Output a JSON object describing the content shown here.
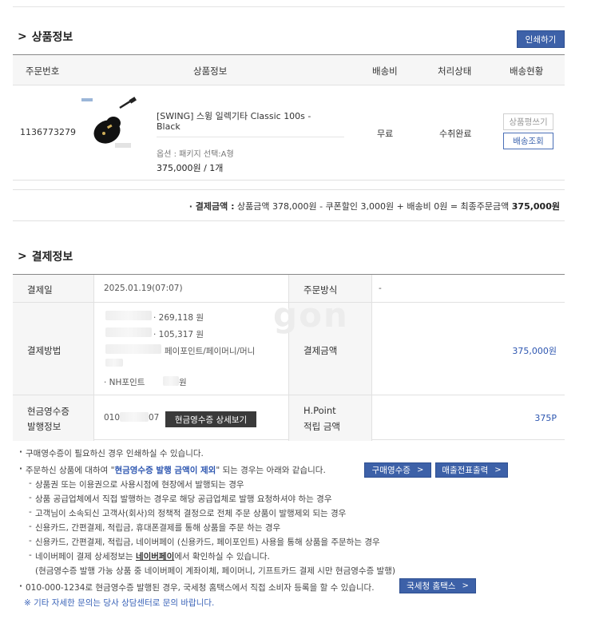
{
  "product_section": {
    "title": "상품정보",
    "print_button": "인쇄하기",
    "headers": [
      "주문번호",
      "상품정보",
      "배송비",
      "처리상태",
      "배송현황"
    ],
    "order": {
      "order_no": "1136773279",
      "product_name_line1": "[SWING] 스윙 일렉기타 Classic 100s -",
      "product_name_line2": "Black",
      "option": "옵션 : 패키지 선택:A형",
      "price_qty": "375,000원 / 1개",
      "shipping_fee": "무료",
      "status": "수취완료",
      "review_button": "상품평쓰기",
      "tracking_button": "배송조회"
    },
    "payment_summary_label": "· 결제금액 :",
    "payment_summary_text": "상품금액 378,000원 - 쿠폰할인 3,000원 + 배송비 0원 = 최종주문금액",
    "payment_summary_total": "375,000원"
  },
  "payment_section": {
    "title": "결제정보",
    "pay_date_label": "결제일",
    "pay_date_value": "2025.01.19(07:07)",
    "order_method_label": "주문방식",
    "order_method_value": "-",
    "pay_method_label": "결제방법",
    "pay_method_lines": [
      "· 269,118 원",
      "· 105,317 원",
      "페이포인트/페이머니/머니",
      "· NH포인트",
      "원"
    ],
    "pay_amount_label": "결제금액",
    "pay_amount_value": "375,000원",
    "receipt_label_line1": "현금영수증",
    "receipt_label_line2": "발행정보",
    "receipt_value_prefix": "010",
    "receipt_value_suffix": "07",
    "receipt_detail_button": "현금영수증 상세보기",
    "hpoint_label_line1": "H.Point",
    "hpoint_label_line2": "적립 금액",
    "hpoint_value": "375P",
    "watermark": "gon"
  },
  "notes": {
    "n1": "구매영수증이 필요하신 경우 인쇄하실 수 있습니다.",
    "n2_pre": "주문하신 상품에 대하여 \"",
    "n2_hl": "현금영수증 발행 금액이 제외",
    "n2_post": "\" 되는 경우는 아래와 같습니다.",
    "btn_purchase_receipt": "구매영수증",
    "btn_sales_slip": "매출전표출력",
    "subs": [
      "상품권 또는 이용권으로 사용시점에 현장에서 발행되는 경우",
      "상품 공급업체에서 직접 발행하는 경우로 해당 공급업체로 발행 요청하셔야 하는 경우",
      "고객님이 소속되신 고객사(회사)의 정책적 결정으로 전체 주문 상품이 발행제외 되는 경우",
      "신용카드, 간편결제, 적립금, 휴대폰결제를 통해 상품을 주문 하는 경우",
      "신용카드, 간편결제, 적립금, 네이버페이 (신용카드, 페이포인트) 사용을 통해 상품을 주문하는 경우"
    ],
    "sub_naver_pre": "네이버페이 결제 상세정보는 ",
    "sub_naver_ul": "네이버페이",
    "sub_naver_post": "에서 확인하실 수 있습니다.",
    "sub_naver_cont": "(현금영수증 발행 가능 상품 중 네이버페이 계좌이체, 페이머니, 기프트카드 결제 시만 현금영수증 발행)",
    "n3": "010-000-1234로 현금영수증 발행된 경우, 국세청 홈택스에서 직접 소비자 등록을 할 수 있습니다.",
    "btn_hometax": "국세청 홈택스",
    "final": "※ 기타 자세한 문의는 당사 상담센터로 문의 바랍니다."
  }
}
